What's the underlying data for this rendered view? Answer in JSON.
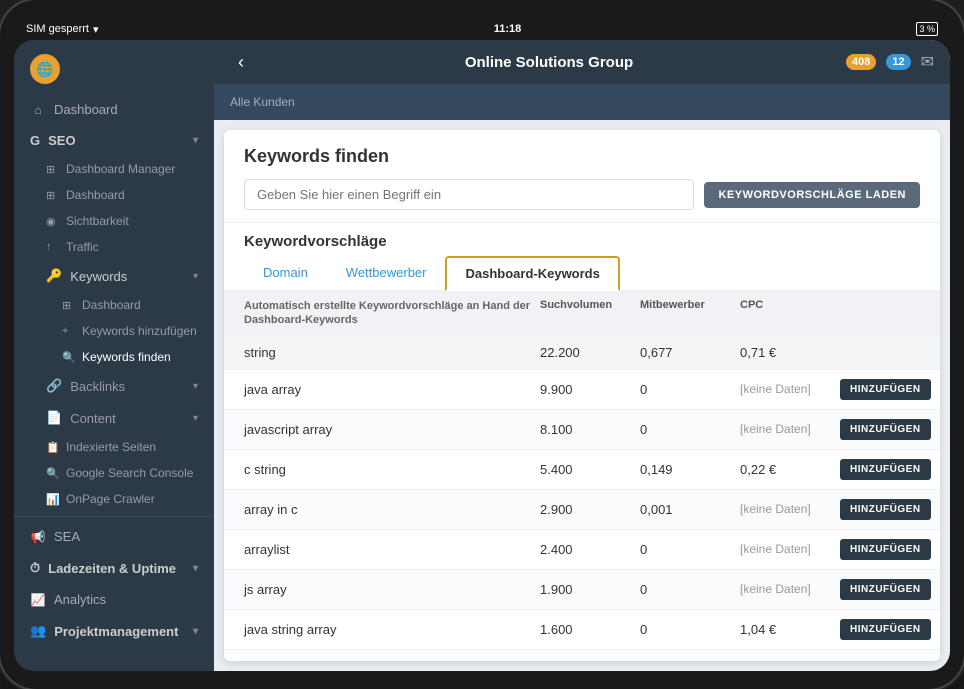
{
  "status_bar": {
    "sim": "SIM gesperrt",
    "wifi_icon": "📶",
    "time": "11:18",
    "battery": "3 %"
  },
  "top_bar": {
    "title": "Online Solutions Group",
    "back_label": "‹",
    "notification_count": "408",
    "notification_count2": "12",
    "sub_nav": "Alle Kunden"
  },
  "sidebar": {
    "dashboard_label": "Dashboard",
    "seo_label": "SEO",
    "items": [
      {
        "id": "dashboard-manager",
        "label": "Dashboard Manager",
        "icon": "⊞"
      },
      {
        "id": "dashboard",
        "label": "Dashboard",
        "icon": "⊞"
      },
      {
        "id": "sichtbarkeit",
        "label": "Sichtbarkeit",
        "icon": "👁"
      },
      {
        "id": "traffic",
        "label": "Traffic",
        "icon": "↑"
      },
      {
        "id": "keywords",
        "label": "Keywords",
        "icon": "🔑",
        "has_chevron": true
      },
      {
        "id": "keywords-dashboard",
        "label": "Dashboard",
        "icon": "⊞"
      },
      {
        "id": "keywords-hinzufuegen",
        "label": "Keywords hinzufügen",
        "icon": "+"
      },
      {
        "id": "keywords-finden",
        "label": "Keywords finden",
        "icon": "🔍",
        "active": true
      },
      {
        "id": "backlinks",
        "label": "Backlinks",
        "icon": "🔗",
        "has_chevron": true
      },
      {
        "id": "content",
        "label": "Content",
        "icon": "📄",
        "has_chevron": true
      },
      {
        "id": "indexierte-seiten",
        "label": "Indexierte Seiten",
        "icon": "📋"
      },
      {
        "id": "google-search",
        "label": "Google Search Console",
        "icon": "🔍"
      },
      {
        "id": "onpage-crawler",
        "label": "OnPage Crawler",
        "icon": "📊"
      },
      {
        "id": "sea",
        "label": "SEA",
        "icon": "📢"
      },
      {
        "id": "ladezeiten",
        "label": "Ladezeiten & Uptime",
        "icon": "⏱",
        "has_chevron": true
      },
      {
        "id": "analytics",
        "label": "Analytics",
        "icon": "📈"
      },
      {
        "id": "projektmanagement",
        "label": "Projektmanagement",
        "icon": "👥",
        "has_chevron": true
      }
    ]
  },
  "keywords_finden": {
    "title": "Keywords finden",
    "search_placeholder": "Geben Sie hier einen Begriff ein",
    "load_button": "KEYWORDVORSCHLÄGE LADEN",
    "section_title": "Keywordvorschläge",
    "tabs": [
      {
        "id": "domain",
        "label": "Domain",
        "active": false
      },
      {
        "id": "wettbewerber",
        "label": "Wettbewerber",
        "active": false
      },
      {
        "id": "dashboard-keywords",
        "label": "Dashboard-Keywords",
        "active": true
      }
    ],
    "table_headers": {
      "keyword": "Automatisch erstellte Keywordvorschläge an Hand der Dashboard-Keywords",
      "suchvolumen": "Suchvolumen",
      "mitbewerber": "Mitbewerber",
      "cpc": "CPC"
    },
    "rows": [
      {
        "keyword": "string",
        "suchvolumen": "22.200",
        "mitbewerber": "0,677",
        "cpc": "0,71 €",
        "show_btn": false
      },
      {
        "keyword": "java array",
        "suchvolumen": "9.900",
        "mitbewerber": "0",
        "cpc": "[keine Daten]",
        "show_btn": true
      },
      {
        "keyword": "javascript array",
        "suchvolumen": "8.100",
        "mitbewerber": "0",
        "cpc": "[keine Daten]",
        "show_btn": true
      },
      {
        "keyword": "c string",
        "suchvolumen": "5.400",
        "mitbewerber": "0,149",
        "cpc": "0,22 €",
        "show_btn": true
      },
      {
        "keyword": "array in c",
        "suchvolumen": "2.900",
        "mitbewerber": "0,001",
        "cpc": "[keine Daten]",
        "show_btn": true
      },
      {
        "keyword": "arraylist",
        "suchvolumen": "2.400",
        "mitbewerber": "0",
        "cpc": "[keine Daten]",
        "show_btn": true
      },
      {
        "keyword": "js array",
        "suchvolumen": "1.900",
        "mitbewerber": "0",
        "cpc": "[keine Daten]",
        "show_btn": true
      },
      {
        "keyword": "java string array",
        "suchvolumen": "1.600",
        "mitbewerber": "0",
        "cpc": "1,04 €",
        "show_btn": true
      }
    ],
    "add_btn_label": "HINZUFÜGEN"
  }
}
